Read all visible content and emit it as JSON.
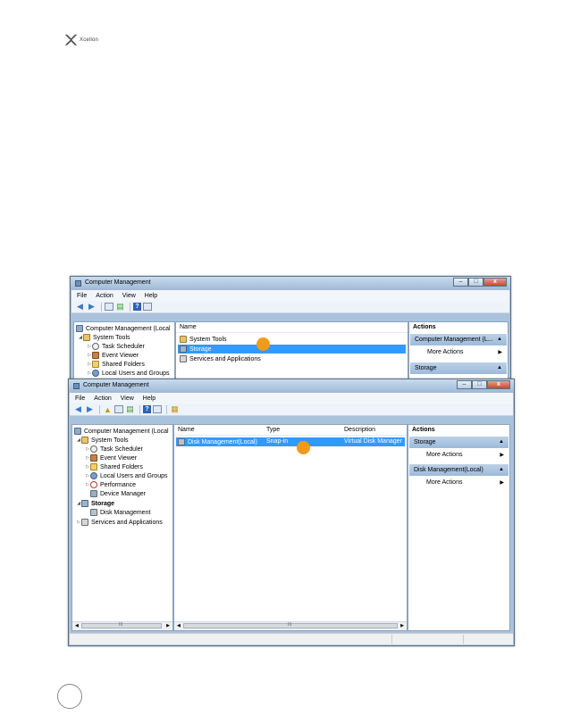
{
  "logo": {
    "text": "Xcellon",
    "icon": "xcellon-logo-icon"
  },
  "window1": {
    "title": "Computer Management",
    "controls": [
      "minimize",
      "maximize",
      "close"
    ],
    "menu": [
      "File",
      "Action",
      "View",
      "Help"
    ],
    "tree": [
      {
        "label": "Computer Management (Local",
        "icon": "computer-icon"
      },
      {
        "label": "System Tools",
        "icon": "tools-icon"
      },
      {
        "label": "Task Scheduler",
        "icon": "clock-icon"
      },
      {
        "label": "Event Viewer",
        "icon": "event-viewer-icon"
      },
      {
        "label": "Shared Folders",
        "icon": "folder-icon"
      },
      {
        "label": "Local Users and Groups",
        "icon": "users-icon"
      }
    ],
    "list_header": "Name",
    "list": [
      {
        "label": "System Tools",
        "selected": false,
        "icon": "tools-icon"
      },
      {
        "label": "Storage",
        "selected": true,
        "icon": "storage-icon"
      },
      {
        "label": "Services and Applications",
        "selected": false,
        "icon": "services-icon"
      }
    ],
    "actions": {
      "title": "Actions",
      "section1": "Computer Management (L...",
      "item1": "More Actions",
      "section2": "Storage"
    }
  },
  "window2": {
    "title": "Computer Management",
    "controls": [
      "minimize",
      "maximize",
      "close"
    ],
    "menu": [
      "File",
      "Action",
      "View",
      "Help"
    ],
    "tree": [
      {
        "label": "Computer Management (Local",
        "icon": "computer-icon"
      },
      {
        "label": "System Tools",
        "icon": "tools-icon"
      },
      {
        "label": "Task Scheduler",
        "icon": "clock-icon"
      },
      {
        "label": "Event Viewer",
        "icon": "event-viewer-icon"
      },
      {
        "label": "Shared Folders",
        "icon": "folder-icon"
      },
      {
        "label": "Local Users and Groups",
        "icon": "users-icon"
      },
      {
        "label": "Performance",
        "icon": "performance-icon"
      },
      {
        "label": "Device Manager",
        "icon": "device-manager-icon"
      },
      {
        "label": "Storage",
        "icon": "storage-icon"
      },
      {
        "label": "Disk Management",
        "icon": "disk-icon"
      },
      {
        "label": "Services and Applications",
        "icon": "services-icon"
      }
    ],
    "columns": [
      "Name",
      "Type",
      "Description"
    ],
    "rows": [
      {
        "name": "Disk Management(Local)",
        "type": "Snap-in",
        "description": "Virtual Disk Manager",
        "selected": true
      }
    ],
    "actions": {
      "title": "Actions",
      "section1": "Storage",
      "item1": "More Actions",
      "section2": "Disk Management(Local)",
      "item2": "More Actions"
    },
    "scrollbar_grip": "III"
  },
  "colors": {
    "selection": "#3399ff",
    "marker": "#f39a1a",
    "action_header": "#a8c2df"
  }
}
